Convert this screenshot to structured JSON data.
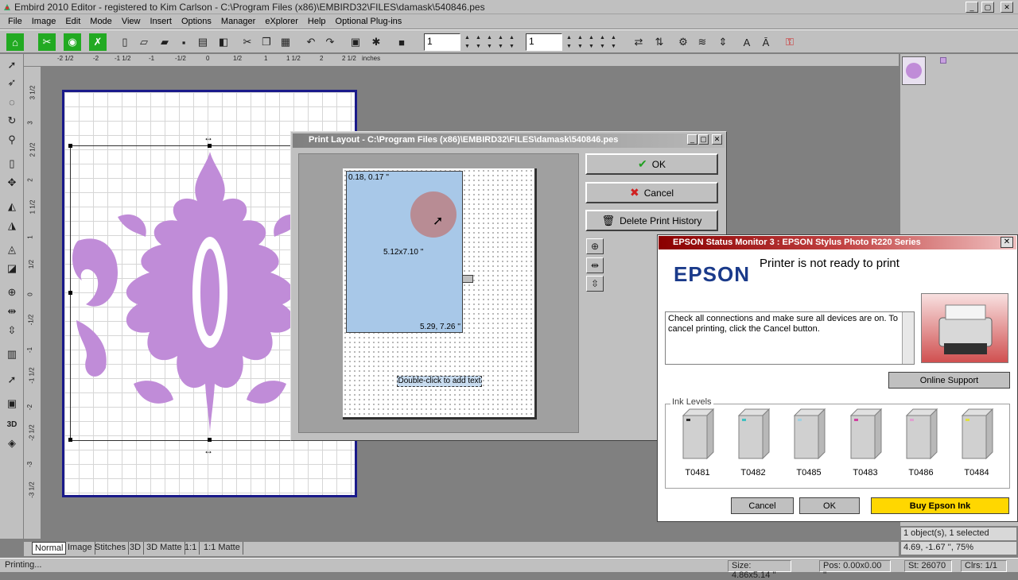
{
  "window": {
    "title": "Embird 2010 Editor - registered to Kim Carlson - C:\\Program Files (x86)\\EMBIRD32\\FILES\\damask\\540846.pes"
  },
  "menu": [
    "File",
    "Image",
    "Edit",
    "Mode",
    "View",
    "Insert",
    "Options",
    "Manager",
    "eXplorer",
    "Help",
    "Optional Plug-ins"
  ],
  "toolbar": {
    "spin1": "1",
    "spin2": "1"
  },
  "ruler": {
    "h_labels": [
      "-2 1/2",
      "-2",
      "-1 1/2",
      "-1",
      "-1/2",
      "0",
      "1/2",
      "1",
      "1 1/2",
      "2",
      "2 1/2",
      "inches"
    ],
    "v_labels": [
      "3 1/2",
      "3",
      "2 1/2",
      "2",
      "1 1/2",
      "1",
      "1/2",
      "0",
      "-1/2",
      "-1",
      "-1 1/2",
      "-2",
      "-2 1/2",
      "-3",
      "-3 1/2"
    ]
  },
  "print_layout": {
    "title": "Print Layout - C:\\Program Files (x86)\\EMBIRD32\\FILES\\damask\\540846.pes",
    "top_left": "0.18, 0.17 ''",
    "size": "5.12x7.10 ''",
    "bottom_right": "5.29, 7.26 ''",
    "text_hint": "Double-click to add text",
    "ok": "OK",
    "cancel": "Cancel",
    "delete_history": "Delete Print History"
  },
  "epson": {
    "title": "EPSON Status Monitor 3 : EPSON Stylus Photo R220 Series",
    "logo": "EPSON",
    "status": "Printer is not ready to print",
    "message": "Check all connections and make sure all devices are on. To cancel printing, click the Cancel button.",
    "online_support": "Online Support",
    "ink_levels_label": "Ink Levels",
    "inks": [
      {
        "code": "T0481",
        "color": "#303030"
      },
      {
        "code": "T0482",
        "color": "#40c0c0"
      },
      {
        "code": "T0485",
        "color": "#a0d0e0"
      },
      {
        "code": "T0483",
        "color": "#d040a0"
      },
      {
        "code": "T0486",
        "color": "#e0a0d0"
      },
      {
        "code": "T0484",
        "color": "#e0e040"
      }
    ],
    "cancel": "Cancel",
    "ok": "OK",
    "buy": "Buy Epson Ink",
    "buy_color": "#ffd700"
  },
  "tabs": [
    "Normal",
    "Image",
    "Stitches",
    "3D",
    "3D Matte",
    "1:1",
    "1:1 Matte"
  ],
  "info": {
    "objects": "1 object(s), 1 selected",
    "coords": "4.69, -1.67 '', 75%"
  },
  "status": {
    "left": "Printing...",
    "size": "Size: 4.86x5.14 ''",
    "pos": "Pos: 0.00x0.00 ''",
    "st": "St: 26070",
    "clrs": "Clrs: 1/1"
  },
  "design_color": "#c08cd8"
}
